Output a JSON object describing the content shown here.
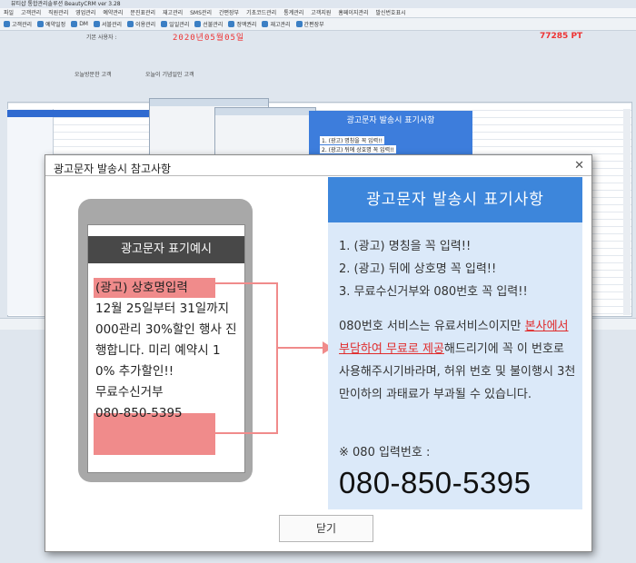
{
  "background": {
    "title": "뷰티샵 통합관리솔루션 BeautyCRM ver 3.28",
    "menu": [
      "파일",
      "고객관리",
      "직원관리",
      "영업관리",
      "예약관리",
      "문진표관리",
      "재고관리",
      "SMS관리",
      "간편장부",
      "기초코드관리",
      "통계관리",
      "고객지원",
      "홈페이지관리",
      "발신번호표시"
    ],
    "toolbar": [
      "고객관리",
      "예약일정",
      "DM",
      "서블관리",
      "이용관리",
      "일일관리",
      "선불관리",
      "정액권리",
      "재고관리",
      "간편장부"
    ],
    "points": "77285 PT",
    "date": "2020년05월05일",
    "top_label": "기본 사용자 :",
    "filter_label": "오늘방문한 고객",
    "birthday_label": "오늘이 기념일인 고객",
    "ghost_heading": "광고문자 발송시 표기사항",
    "ghost_rules": [
      "1. (광고) 명칭을 꼭 입력!!",
      "2. (광고) 뒤에 상호명 꼭 입력!!"
    ]
  },
  "dialog": {
    "title": "광고문자 발송시 참고사항",
    "phone_header": "광고문자 표기예시",
    "phone_line1": "(광고) 상호명입력",
    "phone_body": "12월 25일부터 31일까지 000관리 30%할인 행사 진행합니다. 미리 예약시 10% 추가할인!!",
    "phone_optout": "무료수신거부",
    "phone_number": "080-850-5395",
    "notice_title": "광고문자 발송시 표기사항",
    "rules": [
      "1. (광고) 명칭을 꼭 입력!!",
      "2. (광고) 뒤에 상호명 꼭 입력!!",
      "3. 무료수신거부와 080번호 꼭 입력!!"
    ],
    "desc_before": "080번호 서비스는 유료서비스이지만",
    "desc_red": "본사에서 부담하여 무료로 제공",
    "desc_after": "해드리기에 꼭 이 번호로 사용해주시기바라며, 허위 번호 및 불이행시 3천만이하의 과태료가 부과될 수 있습니다.",
    "number_label": "※ 080 입력번호 :",
    "big_number": "080-850-5395",
    "close_label": "닫기",
    "colors": {
      "accent": "#3d86db",
      "highlight": "#f08b8b",
      "panel": "#dbe9f9",
      "red_text": "#e02b2b"
    }
  }
}
